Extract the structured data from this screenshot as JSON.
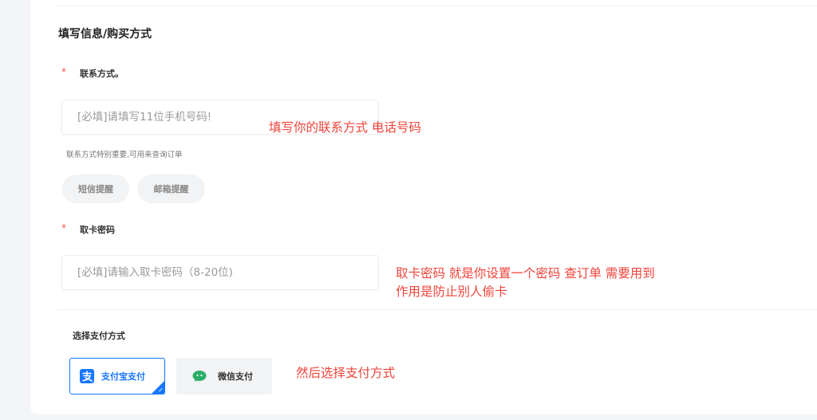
{
  "form": {
    "section_title": "填写信息/购买方式",
    "required_mark": "*",
    "contact": {
      "label": "联系方式。",
      "placeholder": "[必填]请填写11位手机号码!",
      "value": "",
      "hint": "联系方式特别重要,可用来查询订单",
      "notify_sms": "短信提醒",
      "notify_email": "邮箱提醒"
    },
    "card_password": {
      "label": "取卡密码",
      "placeholder": "[必填]请输入取卡密码（8-20位)",
      "value": ""
    },
    "payment": {
      "title": "选择支付方式",
      "options": [
        {
          "label": "支付宝支付",
          "icon": "alipay-icon",
          "selected": true
        },
        {
          "label": "微信支付",
          "icon": "wechat-icon",
          "selected": false
        }
      ],
      "selected_check": "✓"
    }
  },
  "annotations": {
    "contact_note": "填写你的联系方式 电话号码",
    "password_note_line1": "取卡密码 就是你设置一个密码  查订单 需要用到",
    "password_note_line2": "作用是防止别人偷卡",
    "payment_note": "然后选择支付方式"
  },
  "colors": {
    "accent": "#1677ff",
    "required": "#ff4d4f",
    "annotation": "#f0433a",
    "wechat": "#2aae67"
  }
}
